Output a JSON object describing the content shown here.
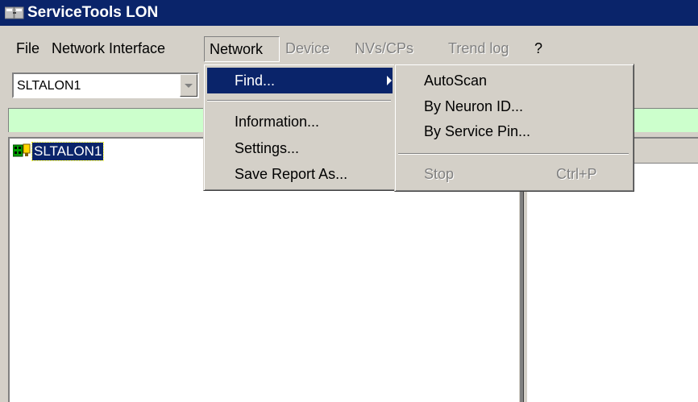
{
  "window": {
    "title": "ServiceTools LON"
  },
  "menubar": {
    "items": [
      {
        "label": "File",
        "enabled": true
      },
      {
        "label": "Network Interface",
        "enabled": true
      },
      {
        "label": "Network",
        "enabled": true,
        "open": true
      },
      {
        "label": "Device",
        "enabled": false
      },
      {
        "label": "NVs/CPs",
        "enabled": false
      },
      {
        "label": "Trend log",
        "enabled": false
      },
      {
        "label": "?",
        "enabled": true
      }
    ]
  },
  "toolbar": {
    "interface_select": {
      "value": "SLTALON1"
    }
  },
  "tree": {
    "nodes": [
      {
        "label": "SLTALON1",
        "icon": "network-interface-icon",
        "selected": true
      }
    ]
  },
  "network_menu": {
    "items": [
      {
        "label": "Find...",
        "has_submenu": true,
        "highlighted": true
      },
      {
        "label": "Information..."
      },
      {
        "label": "Settings..."
      },
      {
        "label": "Save Report As..."
      }
    ]
  },
  "find_submenu": {
    "items": [
      {
        "label": "AutoScan",
        "enabled": true
      },
      {
        "label": "By Neuron ID...",
        "enabled": true
      },
      {
        "label": "By Service Pin...",
        "enabled": true
      },
      {
        "label": "Stop",
        "shortcut": "Ctrl+P",
        "enabled": false
      }
    ]
  },
  "colors": {
    "title_bar": "#0a246a",
    "status_strip": "#ccffcc",
    "face": "#d4d0c8",
    "highlight": "#0a246a"
  }
}
